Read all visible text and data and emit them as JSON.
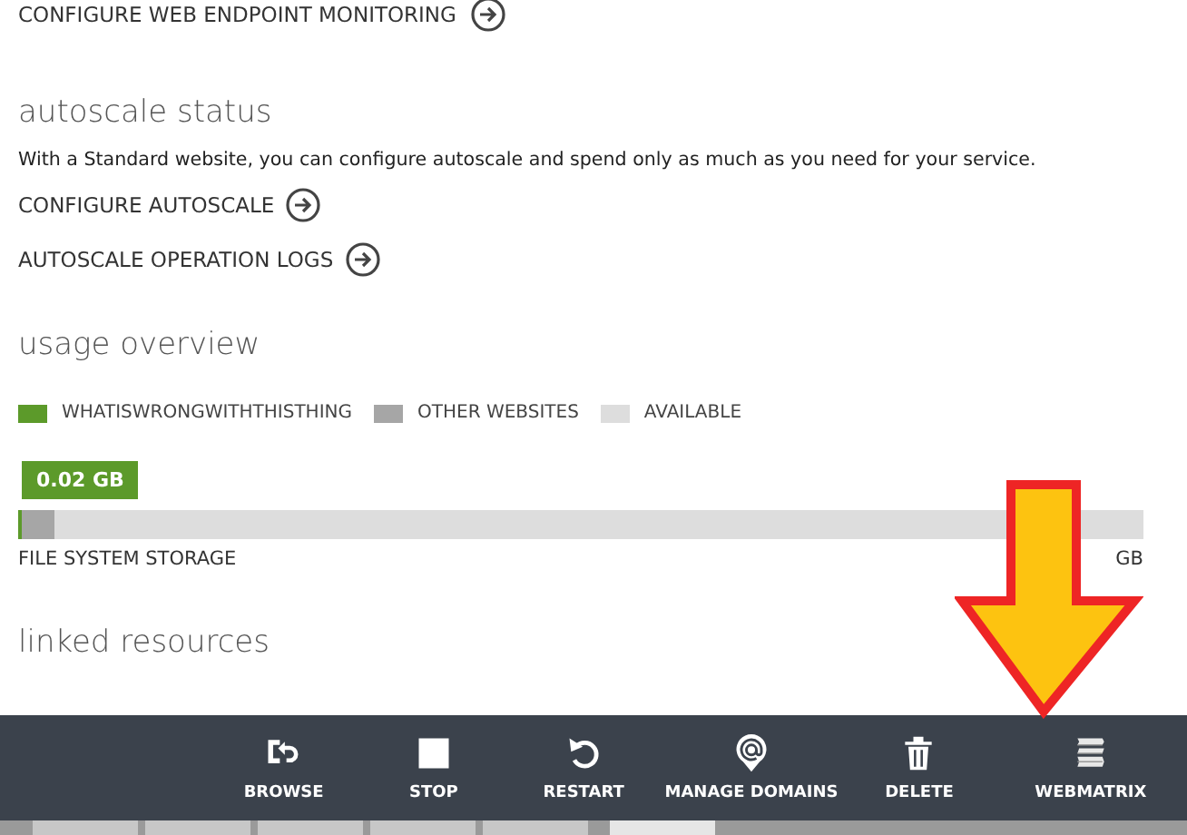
{
  "top_link": {
    "label": "CONFIGURE WEB ENDPOINT MONITORING"
  },
  "autoscale": {
    "title": "autoscale status",
    "description": "With a Standard website, you can configure autoscale and spend only as much as you need for your service.",
    "links": [
      {
        "label": "CONFIGURE AUTOSCALE"
      },
      {
        "label": "AUTOSCALE OPERATION LOGS"
      }
    ]
  },
  "usage": {
    "title": "usage overview",
    "legend": [
      {
        "label": "WHATISWRONGWITHTHISTHING",
        "color": "#5c9a2a"
      },
      {
        "label": "OTHER WEBSITES",
        "color": "#a6a6a6"
      },
      {
        "label": "AVAILABLE",
        "color": "#dddddd"
      }
    ],
    "meter": {
      "tooltip": "0.02 GB",
      "segments": [
        {
          "level": 0.003,
          "color": "#5c9a2a"
        },
        {
          "level": 0.03,
          "color": "#a6a6a6"
        }
      ],
      "label": "FILE SYSTEM STORAGE",
      "max_label": "GB"
    }
  },
  "linked": {
    "title": "linked resources"
  },
  "toolbar": [
    {
      "label": "BROWSE",
      "kind": "browse"
    },
    {
      "label": "STOP",
      "kind": "stop"
    },
    {
      "label": "RESTART",
      "kind": "restart"
    },
    {
      "label": "MANAGE DOMAINS",
      "kind": "domains"
    },
    {
      "label": "DELETE",
      "kind": "delete"
    },
    {
      "label": "WEBMATRIX",
      "kind": "webmatrix"
    }
  ]
}
